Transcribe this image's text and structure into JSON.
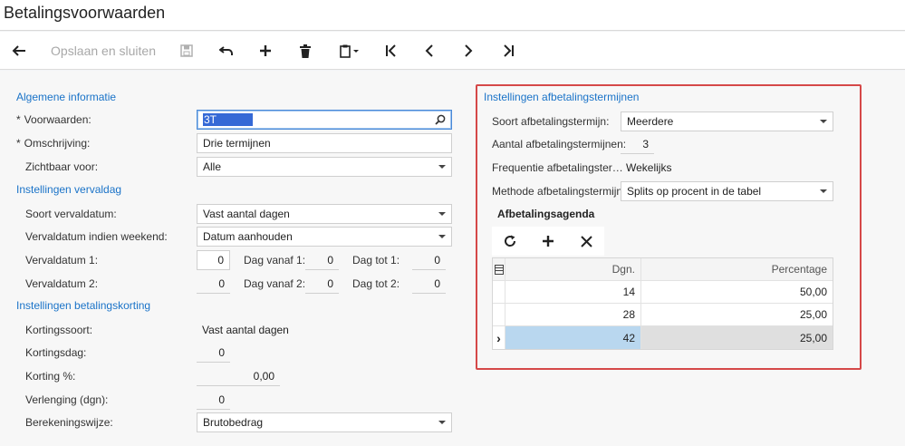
{
  "page": {
    "title": "Betalingsvoorwaarden"
  },
  "toolbar": {
    "save_close_label": "Opslaan en sluiten",
    "icons": [
      "back-arrow-icon",
      "save-disk-icon",
      "undo-icon",
      "plus-icon",
      "trash-icon",
      "clipboard-icon",
      "first-record-icon",
      "previous-icon",
      "next-icon",
      "last-record-icon"
    ]
  },
  "general": {
    "header": "Algemene informatie",
    "terms_label": "Voorwaarden:",
    "terms_value": "3T",
    "description_label": "Omschrijving:",
    "description_value": "Drie termijnen",
    "visible_label": "Zichtbaar voor:",
    "visible_value": "Alle"
  },
  "due": {
    "header": "Instellingen vervaldag",
    "type_label": "Soort vervaldatum:",
    "type_value": "Vast aantal dagen",
    "weekend_label": "Vervaldatum indien weekend:",
    "weekend_value": "Datum aanhouden",
    "due1_label": "Vervaldatum 1:",
    "due1_value": "0",
    "from1_label": "Dag vanaf 1:",
    "from1_value": "0",
    "to1_label": "Dag tot 1:",
    "to1_value": "0",
    "due2_label": "Vervaldatum 2:",
    "due2_value": "0",
    "from2_label": "Dag vanaf 2:",
    "from2_value": "0",
    "to2_label": "Dag tot 2:",
    "to2_value": "0"
  },
  "discount": {
    "header": "Instellingen betalingskorting",
    "type_label": "Kortingssoort:",
    "type_value": "Vast aantal dagen",
    "day_label": "Kortingsdag:",
    "day_value": "0",
    "pct_label": "Korting %:",
    "pct_value": "0,00",
    "ext_label": "Verlenging (dgn):",
    "ext_value": "0",
    "calc_label": "Berekeningswijze:",
    "calc_value": "Brutobedrag"
  },
  "installments": {
    "header": "Instellingen afbetalingstermijnen",
    "type_label": "Soort afbetalingstermijn:",
    "type_value": "Meerdere",
    "count_label": "Aantal afbetalingstermijnen:",
    "count_value": "3",
    "freq_label": "Frequentie afbetalingster…",
    "freq_value": "Wekelijks",
    "method_label": "Methode afbetalingstermijn:",
    "method_value": "Splits op procent in de tabel",
    "schedule_title": "Afbetalingsagenda",
    "grid_headers": {
      "days": "Dgn.",
      "percentage": "Percentage"
    },
    "rows": [
      {
        "days": "14",
        "percentage": "50,00"
      },
      {
        "days": "28",
        "percentage": "25,00"
      },
      {
        "days": "42",
        "percentage": "25,00"
      }
    ],
    "active_row_marker": "›",
    "highlight_color": "#d54848"
  }
}
